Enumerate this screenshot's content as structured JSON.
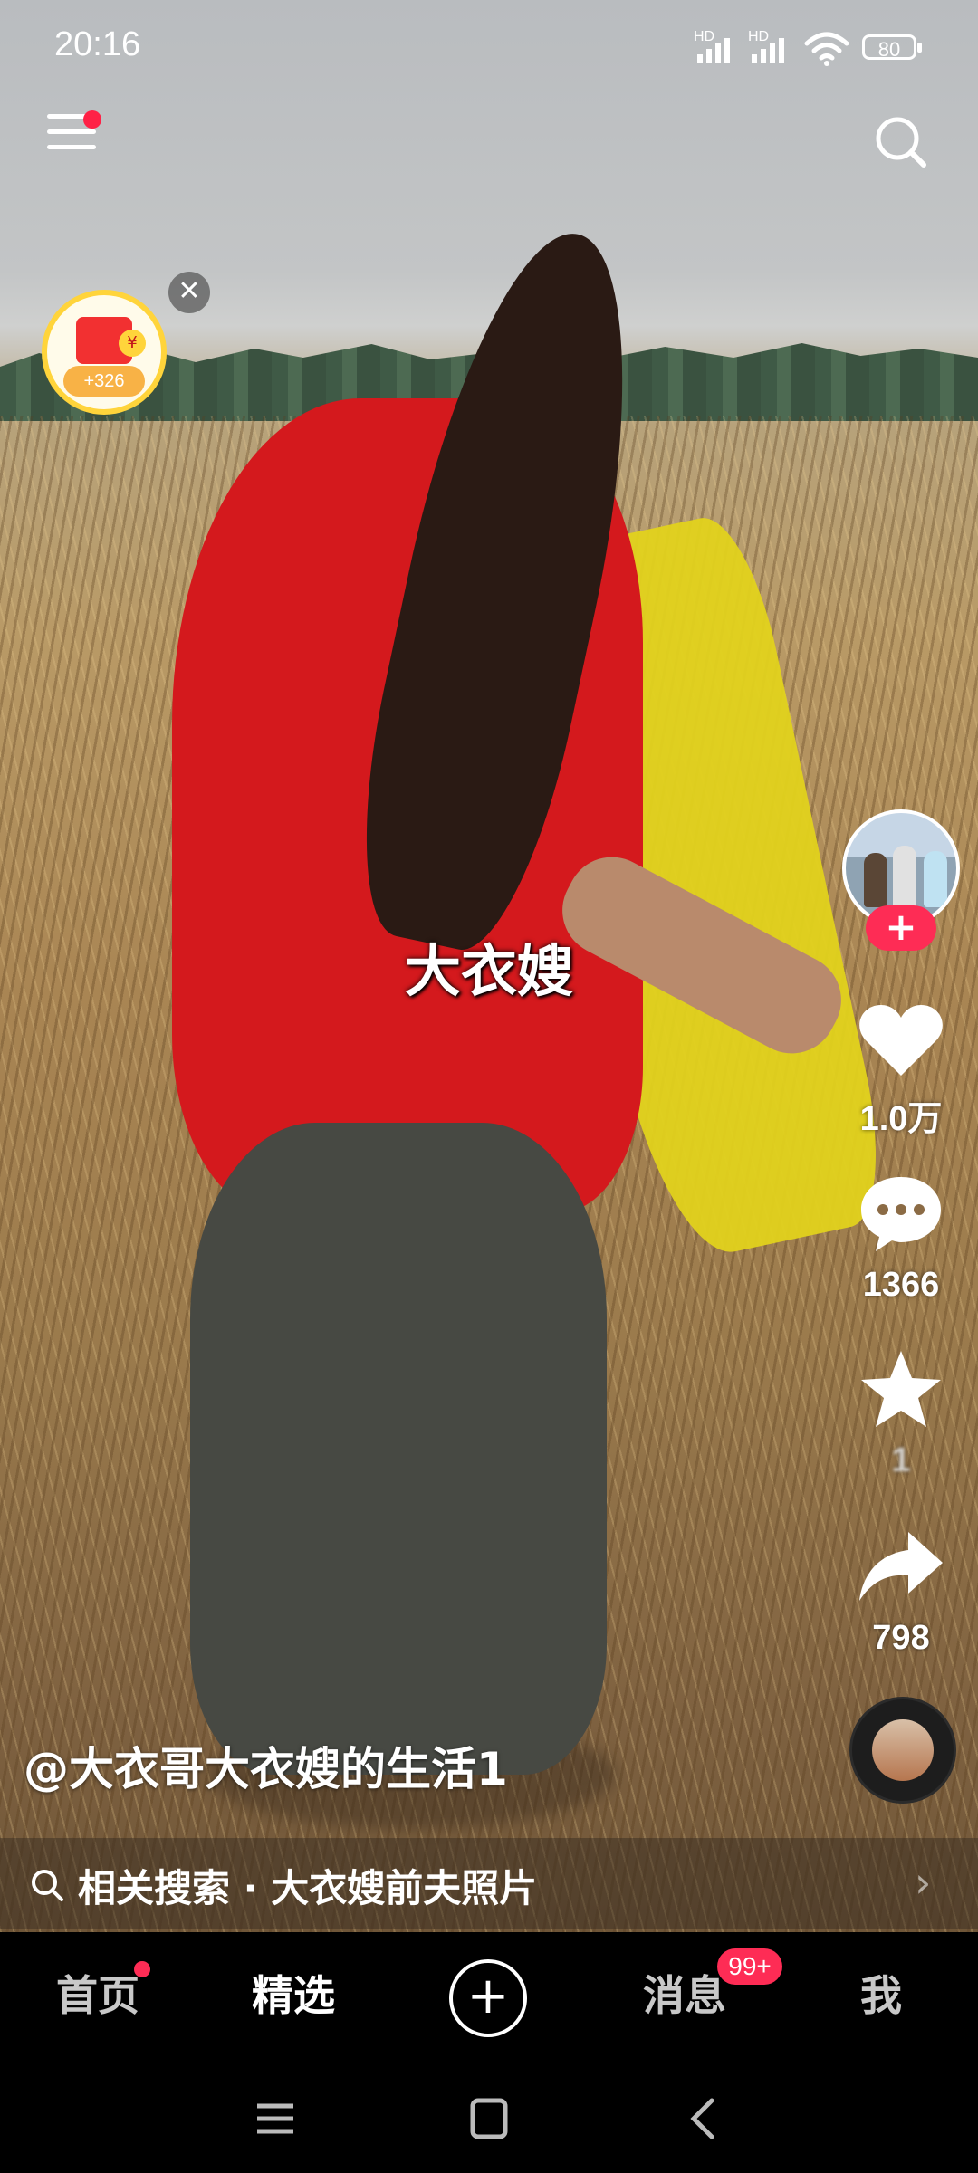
{
  "status_bar": {
    "time": "20:16",
    "signal1_label": "HD",
    "signal2_label": "HD",
    "battery": "80"
  },
  "red_packet": {
    "coin_symbol": "¥",
    "amount": "+326",
    "close_symbol": "✕"
  },
  "video": {
    "subtitle": "大衣嫂",
    "author": "@大衣哥大衣嫂的生活1"
  },
  "actions": {
    "follow_symbol": "+",
    "likes": "1.0万",
    "comments": "1366",
    "favorites": "1",
    "shares": "798"
  },
  "related_search": {
    "text": "相关搜索 · 大衣嫂前夫照片",
    "arrow": "›"
  },
  "tabbar": {
    "home": "首页",
    "featured": "精选",
    "create_symbol": "+",
    "messages": "消息",
    "messages_badge": "99+",
    "me": "我"
  },
  "colors": {
    "accent": "#fe2c55",
    "packet_ring": "#ffd43b",
    "shirt": "#d4191d",
    "banner": "#e2d21c"
  },
  "icons": [
    "menu-icon",
    "search-icon",
    "heart-icon",
    "comment-icon",
    "star-icon",
    "share-icon",
    "music-disc-icon",
    "system-menu-icon",
    "system-home-icon",
    "system-back-icon"
  ]
}
